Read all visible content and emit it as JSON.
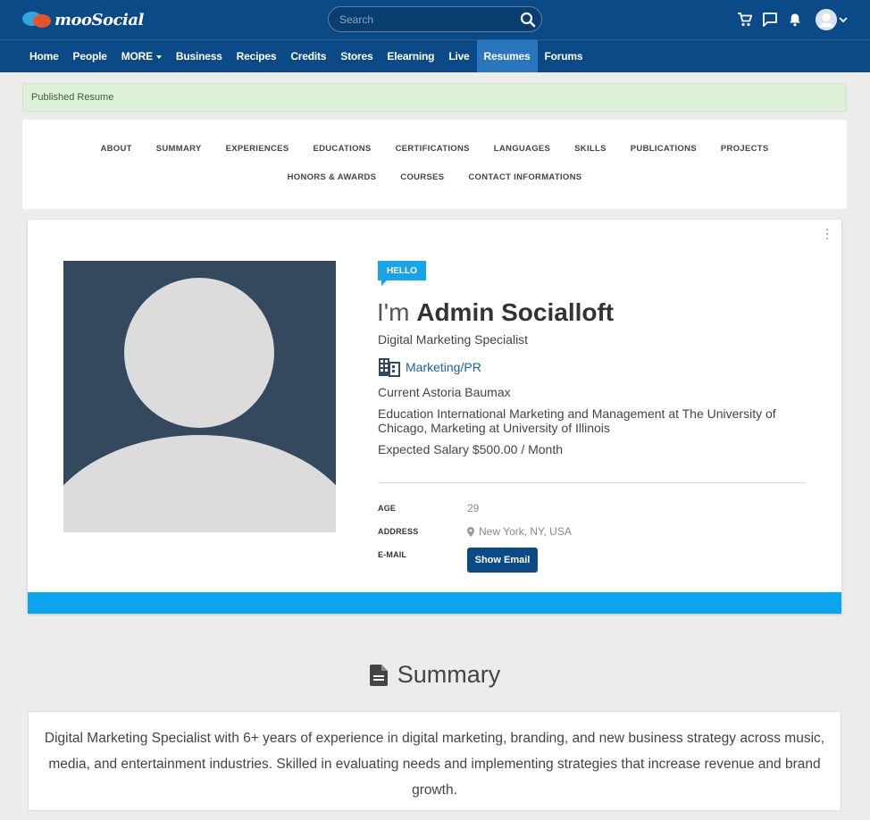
{
  "header": {
    "logo_text": "mooSocial",
    "search_placeholder": "Search"
  },
  "nav": {
    "items": [
      {
        "label": "Home"
      },
      {
        "label": "People"
      },
      {
        "label": "MORE"
      },
      {
        "label": "Business"
      },
      {
        "label": "Recipes"
      },
      {
        "label": "Credits"
      },
      {
        "label": "Stores"
      },
      {
        "label": "Elearning"
      },
      {
        "label": "Live"
      },
      {
        "label": "Resumes"
      },
      {
        "label": "Forums"
      }
    ],
    "active": "Resumes"
  },
  "alert": {
    "text": "Published Resume"
  },
  "section_nav": {
    "row1": [
      "ABOUT",
      "SUMMARY",
      "EXPERIENCES",
      "EDUCATIONS",
      "CERTIFICATIONS",
      "LANGUAGES",
      "SKILLS",
      "PUBLICATIONS",
      "PROJECTS"
    ],
    "row2": [
      "HONORS & AWARDS",
      "COURSES",
      "CONTACT INFORMATIONS"
    ]
  },
  "profile": {
    "badge": "HELLO",
    "greeting_prefix": "I'm",
    "name": "Admin Socialloft",
    "title": "Digital Marketing Specialist",
    "category": "Marketing/PR",
    "current": "Current Astoria Baumax",
    "education": "Education International Marketing and Management at The University of Chicago, Marketing at University of Illinois",
    "salary": "Expected Salary $500.00 / Month",
    "details": {
      "age_label": "AGE",
      "age_value": "29",
      "address_label": "ADDRESS",
      "address_value": "New York, NY, USA",
      "email_label": "E-MAIL",
      "email_button": "Show Email"
    }
  },
  "summary": {
    "heading": "Summary",
    "text": "Digital Marketing Specialist with 6+ years of experience in digital marketing, branding, and new business strategy across music, media, and entertainment industries. Skilled in evaluating needs and implementing strategies that increase revenue and brand growth."
  },
  "colors": {
    "header_bg": "#0b4a86",
    "nav_active": "#2a76bd",
    "accent_blue": "#0aa5ee",
    "alert_bg": "#dff0d8",
    "photo_bg": "#34495e"
  }
}
